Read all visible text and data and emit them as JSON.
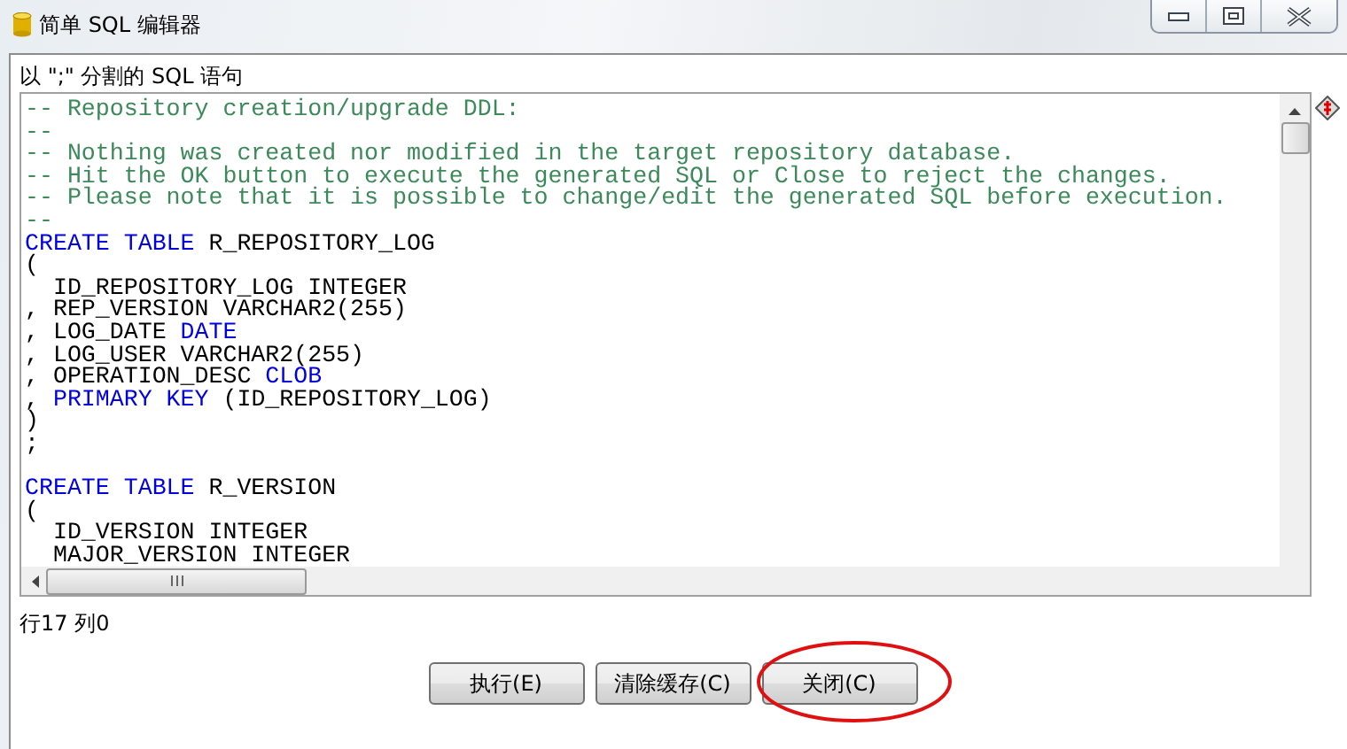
{
  "window": {
    "title": "简单 SQL 编辑器"
  },
  "editor": {
    "label": "以 \";\" 分割的 SQL 语句",
    "lines": [
      {
        "kind": "code",
        "segments": [
          {
            "kind": "comment",
            "text": "-- Repository creation/upgrade DDL:"
          }
        ]
      },
      {
        "kind": "code",
        "segments": [
          {
            "kind": "comment",
            "text": "--"
          }
        ]
      },
      {
        "kind": "code",
        "segments": [
          {
            "kind": "comment",
            "text": "-- Nothing was created nor modified in the target repository database."
          }
        ]
      },
      {
        "kind": "code",
        "segments": [
          {
            "kind": "comment",
            "text": "-- Hit the OK button to execute the generated SQL or Close to reject the changes."
          }
        ]
      },
      {
        "kind": "code",
        "segments": [
          {
            "kind": "comment",
            "text": "-- Please note that it is possible to change/edit the generated SQL before execution."
          }
        ]
      },
      {
        "kind": "code",
        "segments": [
          {
            "kind": "comment",
            "text": "--"
          }
        ]
      },
      {
        "kind": "code",
        "segments": [
          {
            "kind": "keyword",
            "text": "CREATE TABLE"
          },
          {
            "kind": "plain",
            "text": " R_REPOSITORY_LOG"
          }
        ]
      },
      {
        "kind": "code",
        "segments": [
          {
            "kind": "plain",
            "text": "("
          }
        ]
      },
      {
        "kind": "code",
        "segments": [
          {
            "kind": "plain",
            "text": "  ID_REPOSITORY_LOG INTEGER"
          }
        ]
      },
      {
        "kind": "code",
        "segments": [
          {
            "kind": "plain",
            "text": ", REP_VERSION VARCHAR2(255)"
          }
        ]
      },
      {
        "kind": "code",
        "segments": [
          {
            "kind": "plain",
            "text": ", LOG_DATE "
          },
          {
            "kind": "keyword",
            "text": "DATE"
          }
        ]
      },
      {
        "kind": "code",
        "segments": [
          {
            "kind": "plain",
            "text": ", LOG_USER VARCHAR2(255)"
          }
        ]
      },
      {
        "kind": "code",
        "segments": [
          {
            "kind": "plain",
            "text": ", OPERATION_DESC "
          },
          {
            "kind": "keyword",
            "text": "CLOB"
          }
        ]
      },
      {
        "kind": "code",
        "segments": [
          {
            "kind": "plain",
            "text": ", "
          },
          {
            "kind": "keyword",
            "text": "PRIMARY KEY"
          },
          {
            "kind": "plain",
            "text": " (ID_REPOSITORY_LOG)"
          }
        ]
      },
      {
        "kind": "code",
        "segments": [
          {
            "kind": "plain",
            "text": ")"
          }
        ]
      },
      {
        "kind": "code",
        "segments": [
          {
            "kind": "plain",
            "text": ";"
          }
        ]
      },
      {
        "kind": "blank"
      },
      {
        "kind": "code",
        "segments": [
          {
            "kind": "keyword",
            "text": "CREATE TABLE"
          },
          {
            "kind": "plain",
            "text": " R_VERSION"
          }
        ]
      },
      {
        "kind": "code",
        "segments": [
          {
            "kind": "plain",
            "text": "("
          }
        ]
      },
      {
        "kind": "code",
        "segments": [
          {
            "kind": "plain",
            "text": "  ID_VERSION INTEGER"
          }
        ]
      },
      {
        "kind": "code",
        "segments": [
          {
            "kind": "plain",
            "text": "  MAJOR_VERSION INTEGER"
          }
        ]
      }
    ]
  },
  "status": "行17 列0",
  "buttons": [
    {
      "label": "执行(E)",
      "circled": false
    },
    {
      "label": "清除缓存(C)",
      "circled": false
    },
    {
      "label": "关闭(C)",
      "circled": true
    }
  ]
}
